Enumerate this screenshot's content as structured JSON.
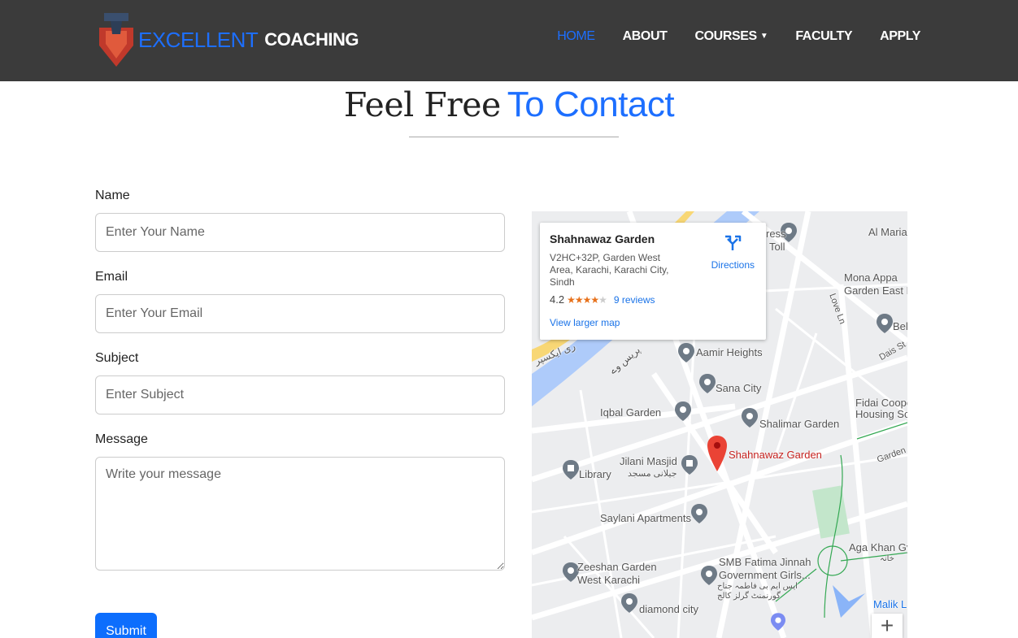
{
  "brand": {
    "name_a": "EXCELLENT",
    "name_b": "COACHING"
  },
  "nav": [
    {
      "label": "HOME",
      "active": true
    },
    {
      "label": "ABOUT"
    },
    {
      "label": "COURSES",
      "dropdown": true
    },
    {
      "label": "FACULTY"
    },
    {
      "label": "APPLY"
    }
  ],
  "heading": {
    "part_a": "Feel Free",
    "part_b": "To Contact"
  },
  "form": {
    "name_label": "Name",
    "name_placeholder": "Enter Your Name",
    "email_label": "Email",
    "email_placeholder": "Enter Your Email",
    "subject_label": "Subject",
    "subject_placeholder": "Enter Subject",
    "message_label": "Message",
    "message_placeholder": "Write your message",
    "submit_label": "Submit"
  },
  "map": {
    "place": "Shahnawaz Garden",
    "address": "V2HC+32P, Garden West Area, Karachi, Karachi City, Sindh",
    "rating": "4.2",
    "reviews": "9 reviews",
    "directions": "Directions",
    "view_larger": "View larger map",
    "labels": {
      "aamir": "Aamir Heights",
      "sana": "Sana City",
      "iqbal": "Iqbal Garden",
      "shalimar": "Shalimar Garden",
      "shahnawaz": "Shahnawaz Garden",
      "jilani": "Jilani Masjid",
      "jilani_ur": "جیلانی مسجد",
      "library": "Library",
      "saylani": "Saylani Apartments",
      "zeeshan1": "Zeeshan Garden",
      "zeeshan2": "West Karachi",
      "smb1": "SMB Fatima Jinnah",
      "smb2": "Government Girls...",
      "smb_ur1": "ایس ایم بی فاطمہ جناح",
      "smb_ur2": "گورنمنٹ گرلز کالج",
      "diamond": "diamond city",
      "fidai1": "Fidai Cooper",
      "fidai2": "Housing Sc",
      "mona1": "Mona Appa",
      "mona2": "Garden East K",
      "almaria": "Al Maria",
      "toll1": "ress",
      "toll2": "Toll",
      "bel": "Bel",
      "loveln": "Love Ln",
      "dais": "Dais St",
      "garden": "Garden",
      "agakhan": "Aga Khan Gy",
      "agakhan_ur": "خانہ",
      "malik": "Malik L",
      "exp_ur": "ری ایکسپر",
      "exp_ur2": "پریس وے"
    },
    "zoom_in": "+"
  },
  "colors": {
    "accent": "#1d6fff",
    "navbar": "#3b3b3b",
    "button": "#0d6efd"
  }
}
